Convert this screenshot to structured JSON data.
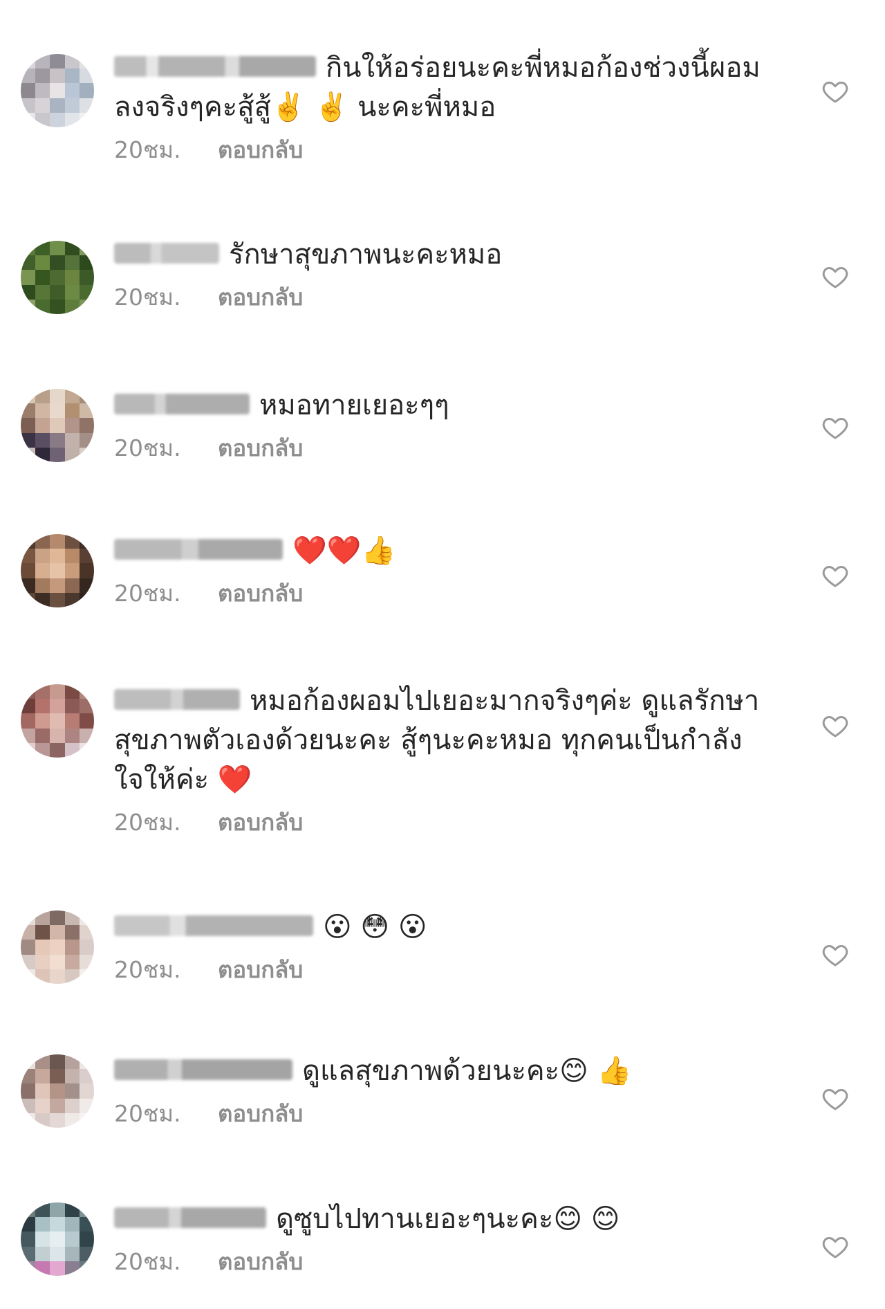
{
  "comments": [
    {
      "text": "กินให้อร่อยนะคะพี่หมอก้องช่วงนี้ผอมลงจริงๆคะสู้สู้✌️ ✌️ นะคะพี่หมอ",
      "time": "20ชม.",
      "reply_label": "ตอบกลับ"
    },
    {
      "text": "รักษาสุขภาพนะคะหมอ",
      "time": "20ชม.",
      "reply_label": "ตอบกลับ"
    },
    {
      "text": "หมอทายเยอะๆๆ",
      "time": "20ชม.",
      "reply_label": "ตอบกลับ"
    },
    {
      "text": "❤️❤️👍",
      "time": "20ชม.",
      "reply_label": "ตอบกลับ"
    },
    {
      "text": "หมอก้องผอมไปเยอะมากจริงๆค่ะ ดูแลรักษาสุขภาพตัวเองด้วยนะคะ สู้ๆนะคะหมอ ทุกคนเป็นกำลังใจให้ค่ะ ❤️",
      "time": "20ชม.",
      "reply_label": "ตอบกลับ"
    },
    {
      "text": "😮 😳 😮",
      "time": "20ชม.",
      "reply_label": "ตอบกลับ"
    },
    {
      "text": "ดูแลสุขภาพด้วยนะคะ😊 👍",
      "time": "20ชม.",
      "reply_label": "ตอบกลับ"
    },
    {
      "text": "ดูซูบไปทานเยอะๆนะคะ😊 😊",
      "time": "20ชม.",
      "reply_label": "ตอบกลับ"
    }
  ],
  "icons": {
    "like": "heart-outline-icon"
  },
  "colors": {
    "text": "#262626",
    "meta": "#8e8e8e"
  }
}
